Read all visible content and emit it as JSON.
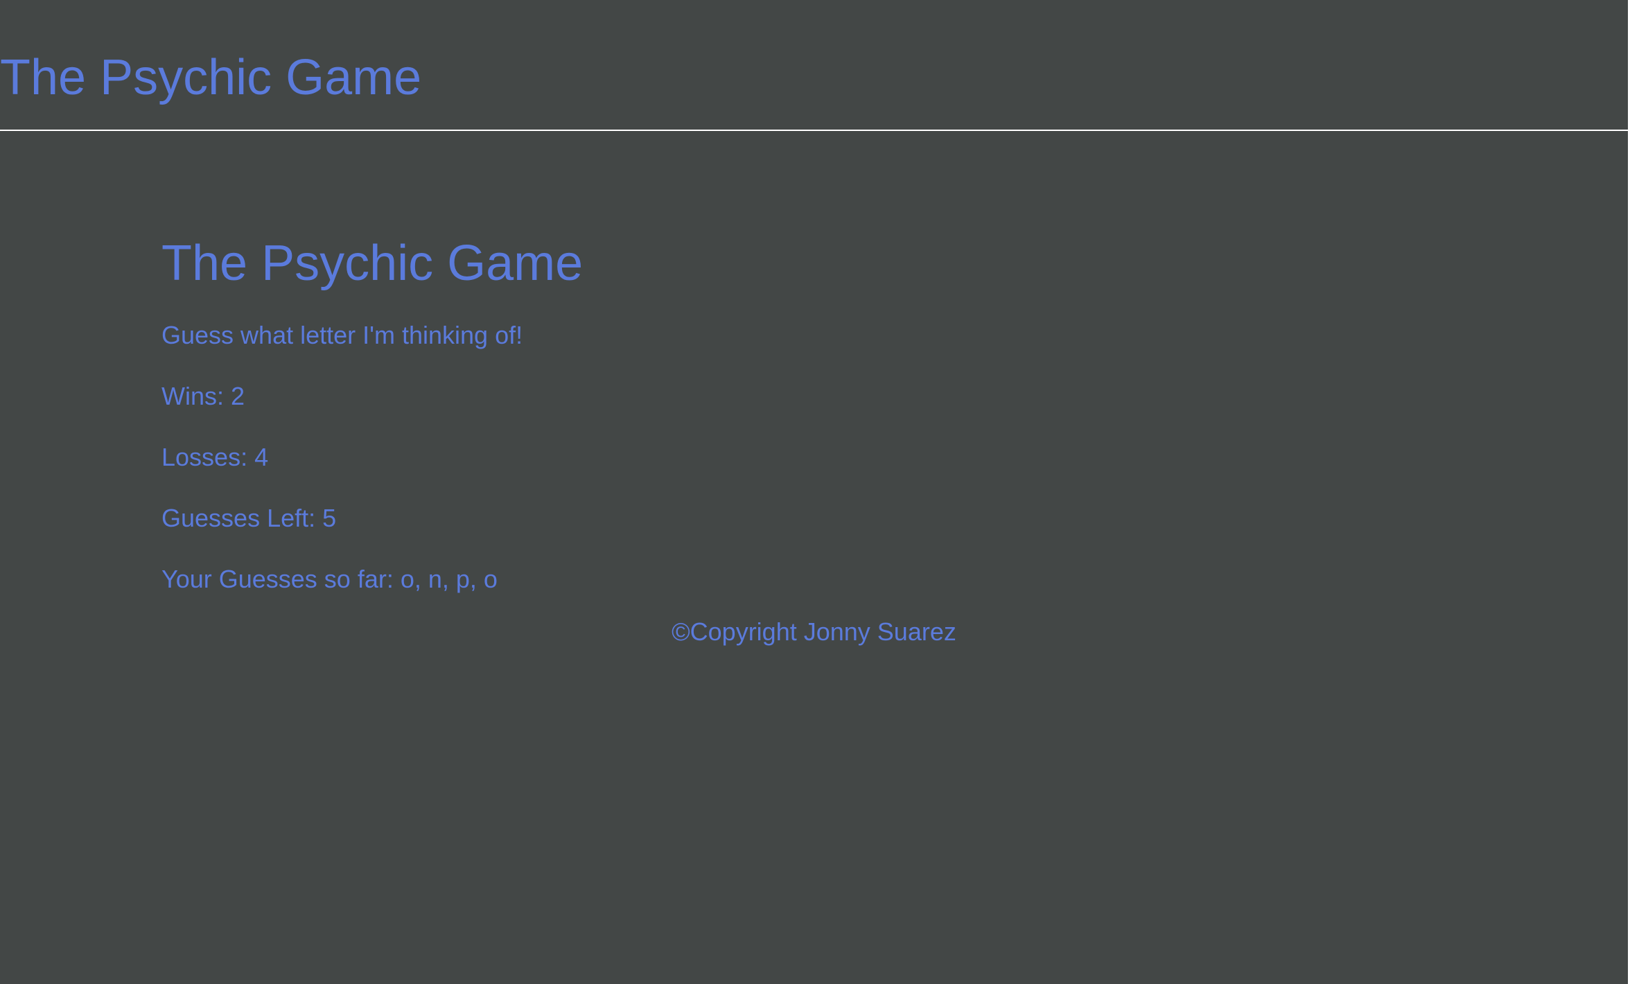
{
  "header": {
    "title": "The Psychic Game"
  },
  "main": {
    "title": "The Psychic Game",
    "tagline": "Guess what letter I'm thinking of!",
    "wins": "Wins: 2",
    "losses": "Losses: 4",
    "guesses_left": "Guesses Left: 5",
    "guesses_so_far": "Your Guesses so far: o, n, p, o"
  },
  "footer": {
    "copyright": "©Copyright Jonny Suarez"
  },
  "colors": {
    "background": "#434746",
    "text": "#5b7bdc",
    "rule": "#ffffff"
  }
}
